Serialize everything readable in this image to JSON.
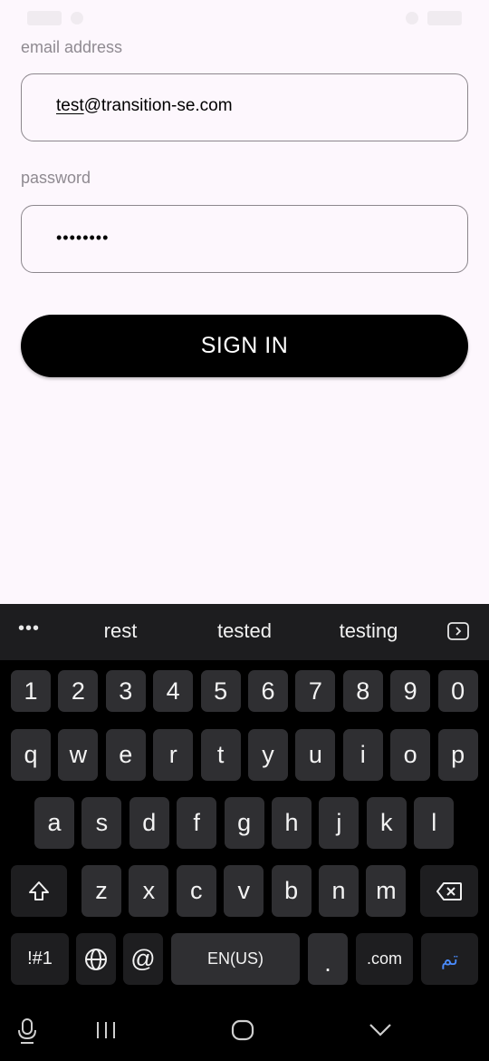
{
  "login": {
    "email_label": "email address",
    "email_value_underlined": "test",
    "email_value_rest": "@transition-se.com",
    "password_label": "password",
    "password_value": "••••••••",
    "sign_in_label": "SIGN IN"
  },
  "keyboard": {
    "more_label": "•••",
    "suggestions": [
      "rest",
      "tested",
      "testing"
    ],
    "number_row": [
      "1",
      "2",
      "3",
      "4",
      "5",
      "6",
      "7",
      "8",
      "9",
      "0"
    ],
    "row1": [
      "q",
      "w",
      "e",
      "r",
      "t",
      "y",
      "u",
      "i",
      "o",
      "p"
    ],
    "row2": [
      "a",
      "s",
      "d",
      "f",
      "g",
      "h",
      "j",
      "k",
      "l"
    ],
    "row3": [
      "z",
      "x",
      "c",
      "v",
      "b",
      "n",
      "m"
    ],
    "symbols_label": "!#1",
    "at_label": "@",
    "space_label": "EN(US)",
    "period_label": ".",
    "dotcom_label": ".com",
    "done_label": "تم",
    "colors": {
      "accent_done": "#4a8cff",
      "background": "#000000",
      "key": "#2f2f32"
    }
  },
  "icons": {
    "expand": "expand-toolbar-icon",
    "shift": "shift-icon",
    "backspace": "backspace-icon",
    "globe": "globe-icon",
    "mic": "mic-icon",
    "recents": "recents-icon",
    "home": "home-icon",
    "back": "back-chevron-icon"
  }
}
